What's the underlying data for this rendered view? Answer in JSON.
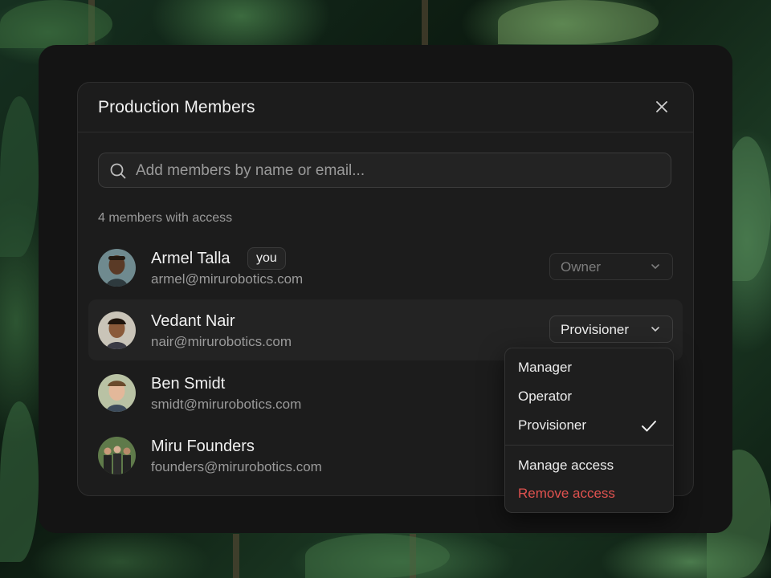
{
  "modal": {
    "title": "Production Members",
    "close_icon": "close-icon"
  },
  "search": {
    "placeholder": "Add members by name or email...",
    "value": ""
  },
  "members_count_label": "4 members with access",
  "members": [
    {
      "name": "Armel Talla",
      "email": "armel@mirurobotics.com",
      "badge": "you",
      "role": "Owner",
      "role_enabled": false
    },
    {
      "name": "Vedant Nair",
      "email": "nair@mirurobotics.com",
      "role": "Provisioner",
      "role_enabled": true
    },
    {
      "name": "Ben Smidt",
      "email": "smidt@mirurobotics.com"
    },
    {
      "name": "Miru Founders",
      "email": "founders@mirurobotics.com"
    }
  ],
  "role_menu": {
    "roles": [
      "Manager",
      "Operator",
      "Provisioner"
    ],
    "selected": "Provisioner",
    "actions": [
      "Manage access",
      "Remove access"
    ]
  },
  "colors": {
    "danger": "#e0524f",
    "surface": "#1c1c1c",
    "text_primary": "#f0f0f0",
    "text_muted": "#9a9a9a"
  }
}
